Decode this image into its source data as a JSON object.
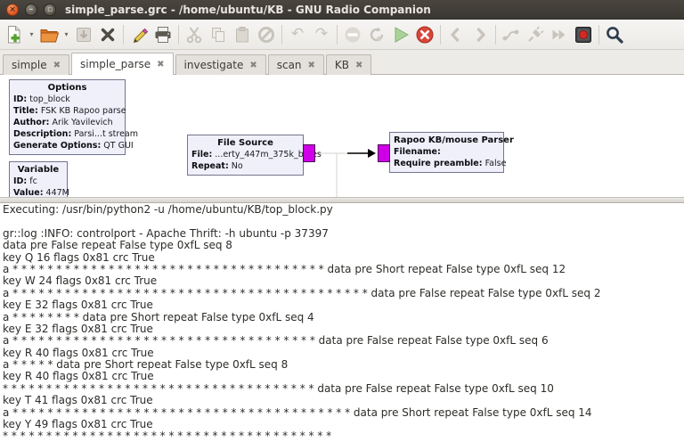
{
  "window": {
    "title": "simple_parse.grc - /home/ubuntu/KB - GNU Radio Companion"
  },
  "toolbar": {
    "glyphs": {
      "dropdown": "▾",
      "undo": "↶",
      "redo": "↷"
    }
  },
  "tabs": {
    "close_glyph": "✖",
    "active_index": 1,
    "items": [
      {
        "label": "simple"
      },
      {
        "label": "simple_parse"
      },
      {
        "label": "investigate"
      },
      {
        "label": "scan"
      },
      {
        "label": "KB"
      }
    ]
  },
  "canvas": {
    "port_color": "#cf00e8",
    "blocks": {
      "options": {
        "title": "Options",
        "params": [
          {
            "label": "ID:",
            "value": "top_block"
          },
          {
            "label": "Title:",
            "value": "FSK KB Rapoo parse"
          },
          {
            "label": "Author:",
            "value": "Arik Yavilevich"
          },
          {
            "label": "Description:",
            "value": "Parsi...t stream"
          },
          {
            "label": "Generate Options:",
            "value": "QT GUI"
          }
        ]
      },
      "variable": {
        "title": "Variable",
        "params": [
          {
            "label": "ID:",
            "value": "fc"
          },
          {
            "label": "Value:",
            "value": "447M"
          }
        ]
      },
      "file_source": {
        "title": "File Source",
        "params": [
          {
            "label": "File:",
            "value": "...erty_447m_375k_bytes"
          },
          {
            "label": "Repeat:",
            "value": "No"
          }
        ]
      },
      "parser": {
        "title": "Rapoo KB/mouse Parser",
        "params": [
          {
            "label": "Filename:",
            "value": ""
          },
          {
            "label": "Require preamble:",
            "value": "False"
          }
        ]
      }
    }
  },
  "console": {
    "lines": [
      "Executing: /usr/bin/python2 -u /home/ubuntu/KB/top_block.py",
      "",
      "gr::log :INFO: controlport - Apache Thrift: -h ubuntu -p 37397",
      "data pre False repeat False type 0xfL seq 8",
      "key Q 16 flags 0x81 crc True",
      "a * * * * * * * * * * * * * * * * * * * * * * * * * * * * * * * * * * * * data pre Short repeat False type 0xfL seq 12",
      "key W 24 flags 0x81 crc True",
      "a * * * * * * * * * * * * * * * * * * * * * * * * * * * * * * * * * * * * * * * * * data pre False repeat False type 0xfL seq 2",
      "key E 32 flags 0x81 crc True",
      "a * * * * * * * * data pre Short repeat False type 0xfL seq 4",
      "key E 32 flags 0x81 crc True",
      "a * * * * * * * * * * * * * * * * * * * * * * * * * * * * * * * * * * * data pre False repeat False type 0xfL seq 6",
      "key R 40 flags 0x81 crc True",
      "a * * * * * data pre Short repeat False type 0xfL seq 8",
      "key R 40 flags 0x81 crc True",
      "* * * * * * * * * * * * * * * * * * * * * * * * * * * * * * * * * * * * data pre False repeat False type 0xfL seq 10",
      "key T 41 flags 0x81 crc True",
      "a * * * * * * * * * * * * * * * * * * * * * * * * * * * * * * * * * * * * * * * data pre Short repeat False type 0xfL seq 14",
      "key Y 49 flags 0x81 crc True",
      "* * * * * * * * * * * * * * * * * * * * * * * * * * * * * * * * * * * * * *"
    ]
  }
}
